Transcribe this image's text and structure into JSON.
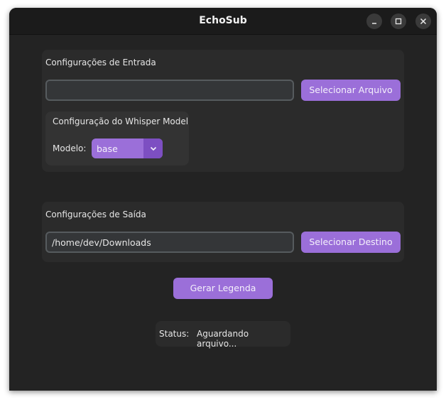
{
  "window": {
    "title": "EchoSub",
    "controls": {
      "minimize": "minimize-icon",
      "maximize": "maximize-icon",
      "close": "close-icon"
    }
  },
  "input_section": {
    "title": "Configurações de Entrada",
    "file_path_value": "",
    "select_button": "Selecionar Arquivo",
    "whisper": {
      "title": "Configuração do Whisper Model",
      "model_label": "Modelo:",
      "model_value": "base"
    }
  },
  "output_section": {
    "title": "Configurações de Saída",
    "destination_value": "/home/dev/Downloads",
    "select_button": "Selecionar Destino"
  },
  "generate_button": "Gerar Legenda",
  "status": {
    "label": "Status:",
    "value": "Aguardando arquivo..."
  },
  "colors": {
    "accent": "#9b6fd9",
    "accent_dark": "#7d4fc2",
    "background": "#232323",
    "panel": "#2b2b2b"
  }
}
